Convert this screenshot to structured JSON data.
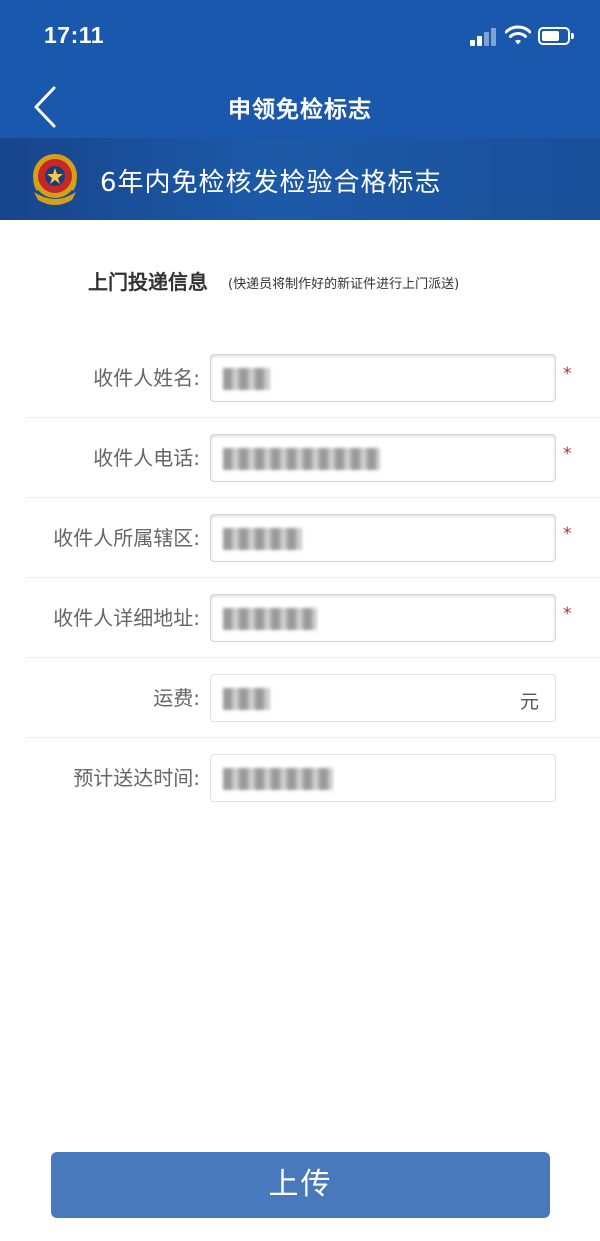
{
  "status_bar": {
    "time": "17:11",
    "signal_icon": "signal-icon",
    "wifi_icon": "wifi-icon",
    "battery_icon": "battery-icon"
  },
  "nav": {
    "back_icon": "chevron-left-icon",
    "title": "申领免检标志"
  },
  "banner": {
    "emblem_icon": "police-emblem-icon",
    "text": "6年内免检核发检验合格标志"
  },
  "section": {
    "title": "上门投递信息",
    "note": "(快递员将制作好的新证件进行上门派送)"
  },
  "form": {
    "fields": [
      {
        "label": "收件人姓名:",
        "value": "●●●",
        "required": "*"
      },
      {
        "label": "收件人电话:",
        "value": "●●●●●●●●●●",
        "required": "*"
      },
      {
        "label": "收件人所属辖区:",
        "value": "●●●●●",
        "required": "*"
      },
      {
        "label": "收件人详细地址:",
        "value": "●●●●●●",
        "required": "*"
      },
      {
        "label": "运费:",
        "value": "●●●",
        "unit": "元"
      },
      {
        "label": "预计送达时间:",
        "value": "●●●●●●●"
      }
    ]
  },
  "actions": {
    "upload_label": "上传"
  },
  "colors": {
    "header_blue": "#1a58ad",
    "banner_blue": "#1c5aa8",
    "button_blue": "#4879bc",
    "required_red": "#c62828"
  }
}
